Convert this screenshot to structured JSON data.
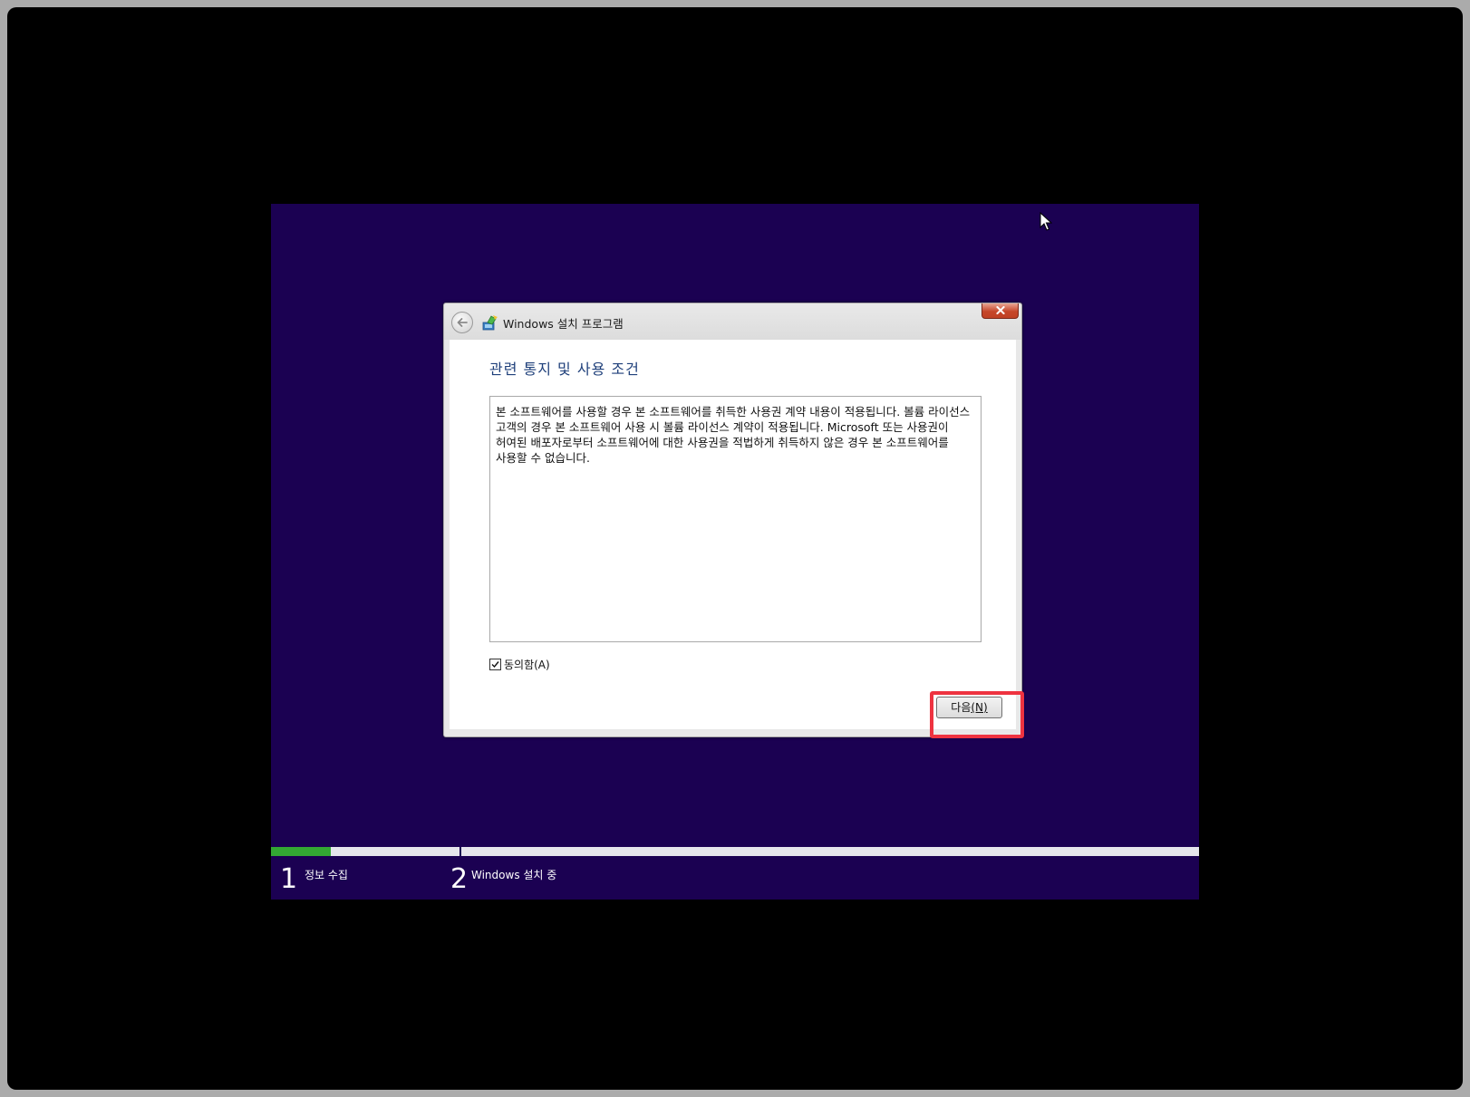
{
  "dialog": {
    "title": "Windows 설치 프로그램",
    "heading": "관련 통지 및 사용 조건",
    "license_text": "본 소프트웨어를 사용할 경우 본 소프트웨어를 취득한 사용권 계약 내용이 적용됩니다. 볼륨 라이선스 고객의 경우 본 소프트웨어 사용 시 볼륨 라이선스 계약이 적용됩니다. Microsoft 또는 사용권이 허여된 배포자로부터 소프트웨어에 대한 사용권을 적법하게 취득하지 않은 경우 본 소프트웨어를 사용할 수 없습니다.",
    "agree_label": "동의함(A)",
    "agree_checked": true,
    "next_label": "다음",
    "next_mnemonic": "(N)"
  },
  "progress": {
    "fraction": 0.064,
    "steps": [
      {
        "number": "1",
        "label": "정보 수집"
      },
      {
        "number": "2",
        "label": "Windows 설치 중"
      }
    ]
  },
  "colors": {
    "screen_background": "#1b0152",
    "progress_fill": "#33a833",
    "highlight": "#ee3340",
    "heading": "#1e3f7a"
  },
  "icons": {
    "back": "back-arrow-icon",
    "app": "windows-setup-icon",
    "close": "close-icon",
    "check": "checkmark-icon",
    "cursor": "mouse-cursor-icon"
  }
}
